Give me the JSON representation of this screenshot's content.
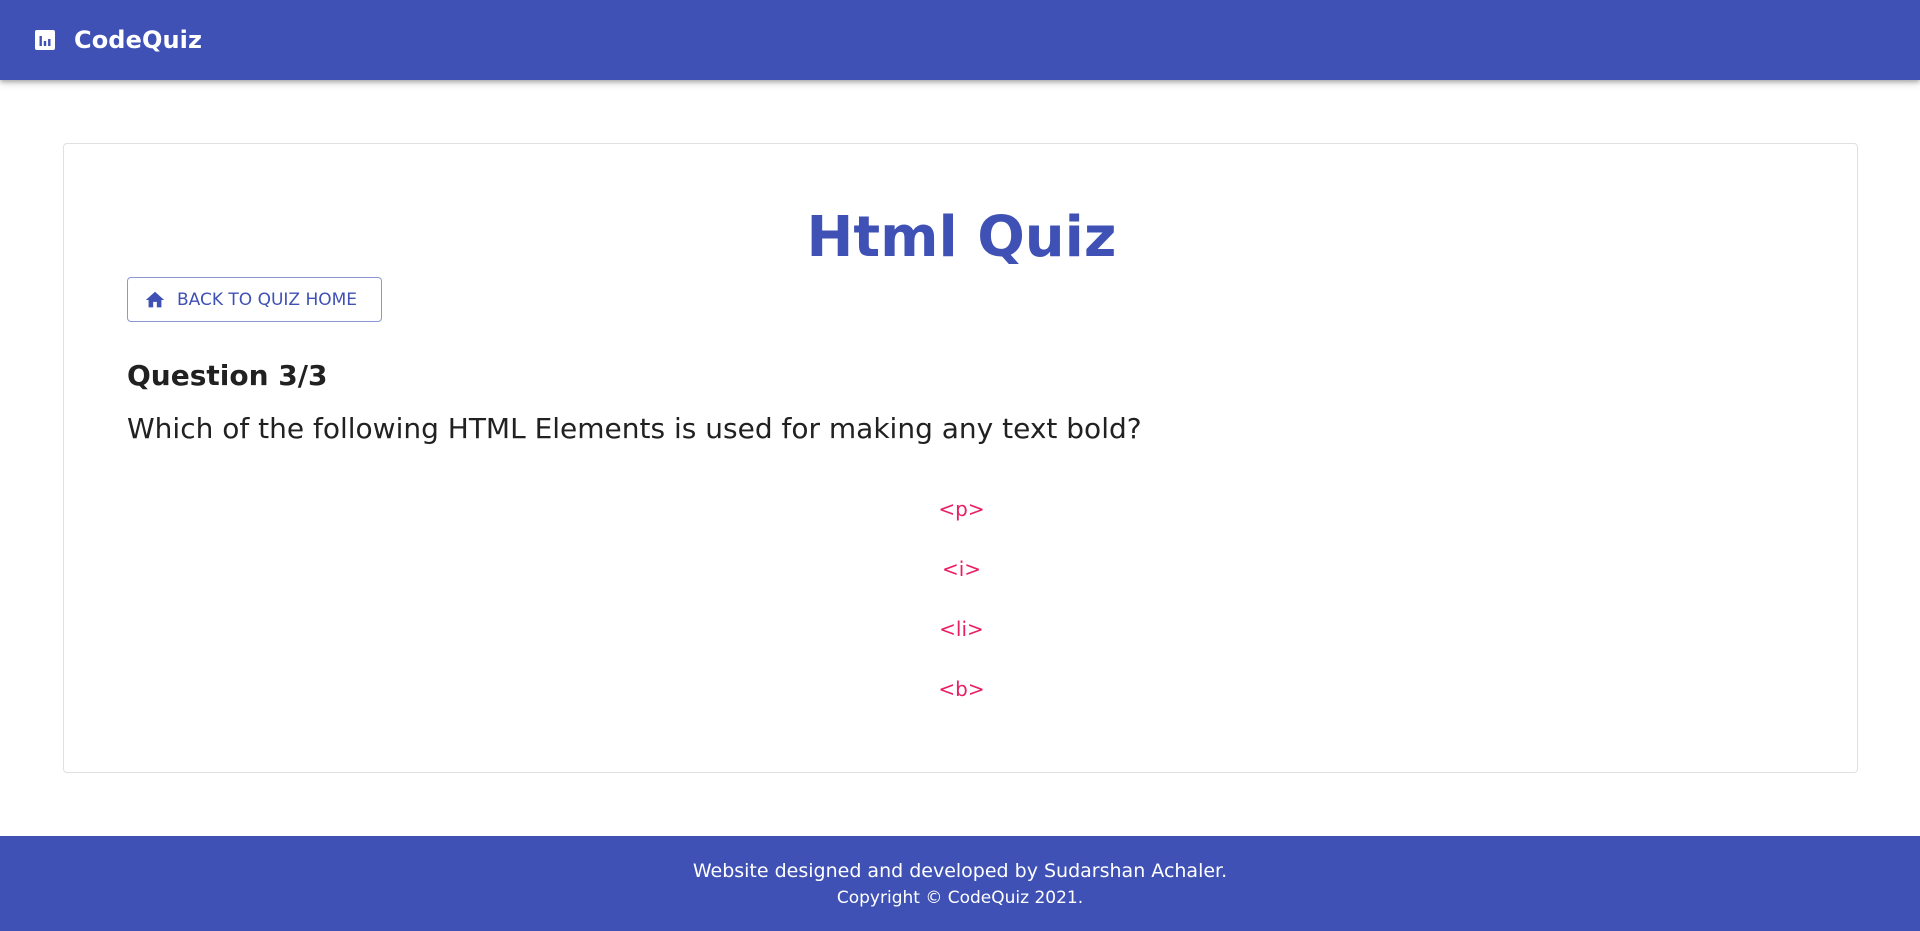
{
  "app": {
    "title": "CodeQuiz",
    "brand_icon": "bar-chart-icon",
    "accent_color": "#3f51b5",
    "option_color": "#e91e63"
  },
  "quiz": {
    "title": "Html Quiz",
    "back_button_label": "BACK TO QUIZ HOME",
    "back_button_icon": "home-icon",
    "question_counter": "Question 3/3",
    "question_text": "Which of the following HTML Elements is used for making any text bold?",
    "options": [
      "<p>",
      "<i>",
      "<li>",
      "<b>"
    ]
  },
  "footer": {
    "credit": "Website designed and developed by Sudarshan Achaler.",
    "copyright": "Copyright © CodeQuiz 2021."
  }
}
